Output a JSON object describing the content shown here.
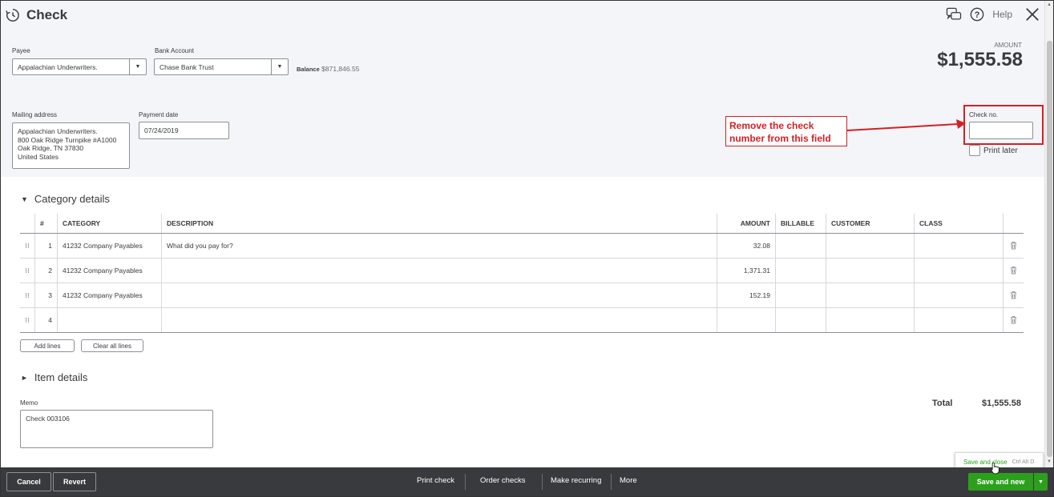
{
  "header": {
    "title": "Check",
    "help_label": "Help",
    "icons": [
      "history-icon",
      "feedback-icon",
      "help-icon",
      "close-icon"
    ]
  },
  "form": {
    "payee_label": "Payee",
    "payee_value": "Appalachian Underwriters.",
    "bank_account_label": "Bank Account",
    "bank_account_value": "Chase Bank Trust",
    "balance_label": "Balance",
    "balance_value": "$871,846.55",
    "amount_label": "AMOUNT",
    "amount_value": "$1,555.58",
    "mailing_address_label": "Mailing address",
    "mailing_address_value": "Appalachian Underwriters.\n800 Oak Ridge Turnpike #A1000\nOak Ridge, TN  37830\nUnited States",
    "payment_date_label": "Payment date",
    "payment_date_value": "07/24/2019",
    "check_no_label": "Check no.",
    "check_no_value": "",
    "print_later_label": "Print later"
  },
  "annotation": {
    "text": "Remove the check number from this field",
    "color": "#d32026"
  },
  "category_details": {
    "title": "Category details",
    "columns": [
      "#",
      "CATEGORY",
      "DESCRIPTION",
      "AMOUNT",
      "BILLABLE",
      "CUSTOMER",
      "CLASS"
    ],
    "rows": [
      {
        "num": "1",
        "category": "41232 Company Payables",
        "description": "",
        "description_placeholder": "What did you pay for?",
        "amount": "32.08"
      },
      {
        "num": "2",
        "category": "41232 Company Payables",
        "description": "",
        "amount": "1,371.31"
      },
      {
        "num": "3",
        "category": "41232 Company Payables",
        "description": "",
        "amount": "152.19"
      },
      {
        "num": "4",
        "category": "",
        "description": "",
        "amount": ""
      }
    ],
    "add_lines_label": "Add lines",
    "clear_all_lines_label": "Clear all lines"
  },
  "item_details": {
    "title": "Item details"
  },
  "memo": {
    "label": "Memo",
    "value": "Check 003106"
  },
  "total": {
    "label": "Total",
    "value": "$1,555.58"
  },
  "tooltip": {
    "label": "Save and close",
    "shortcut": "Ctrl Alt D"
  },
  "footer": {
    "cancel_label": "Cancel",
    "revert_label": "Revert",
    "print_check_label": "Print check",
    "order_checks_label": "Order checks",
    "make_recurring_label": "Make recurring",
    "more_label": "More",
    "save_new_label": "Save and new"
  },
  "colors": {
    "accent_green": "#2ca01c",
    "footer_bg": "#393a3d",
    "header_bg": "#f4f5f8"
  }
}
